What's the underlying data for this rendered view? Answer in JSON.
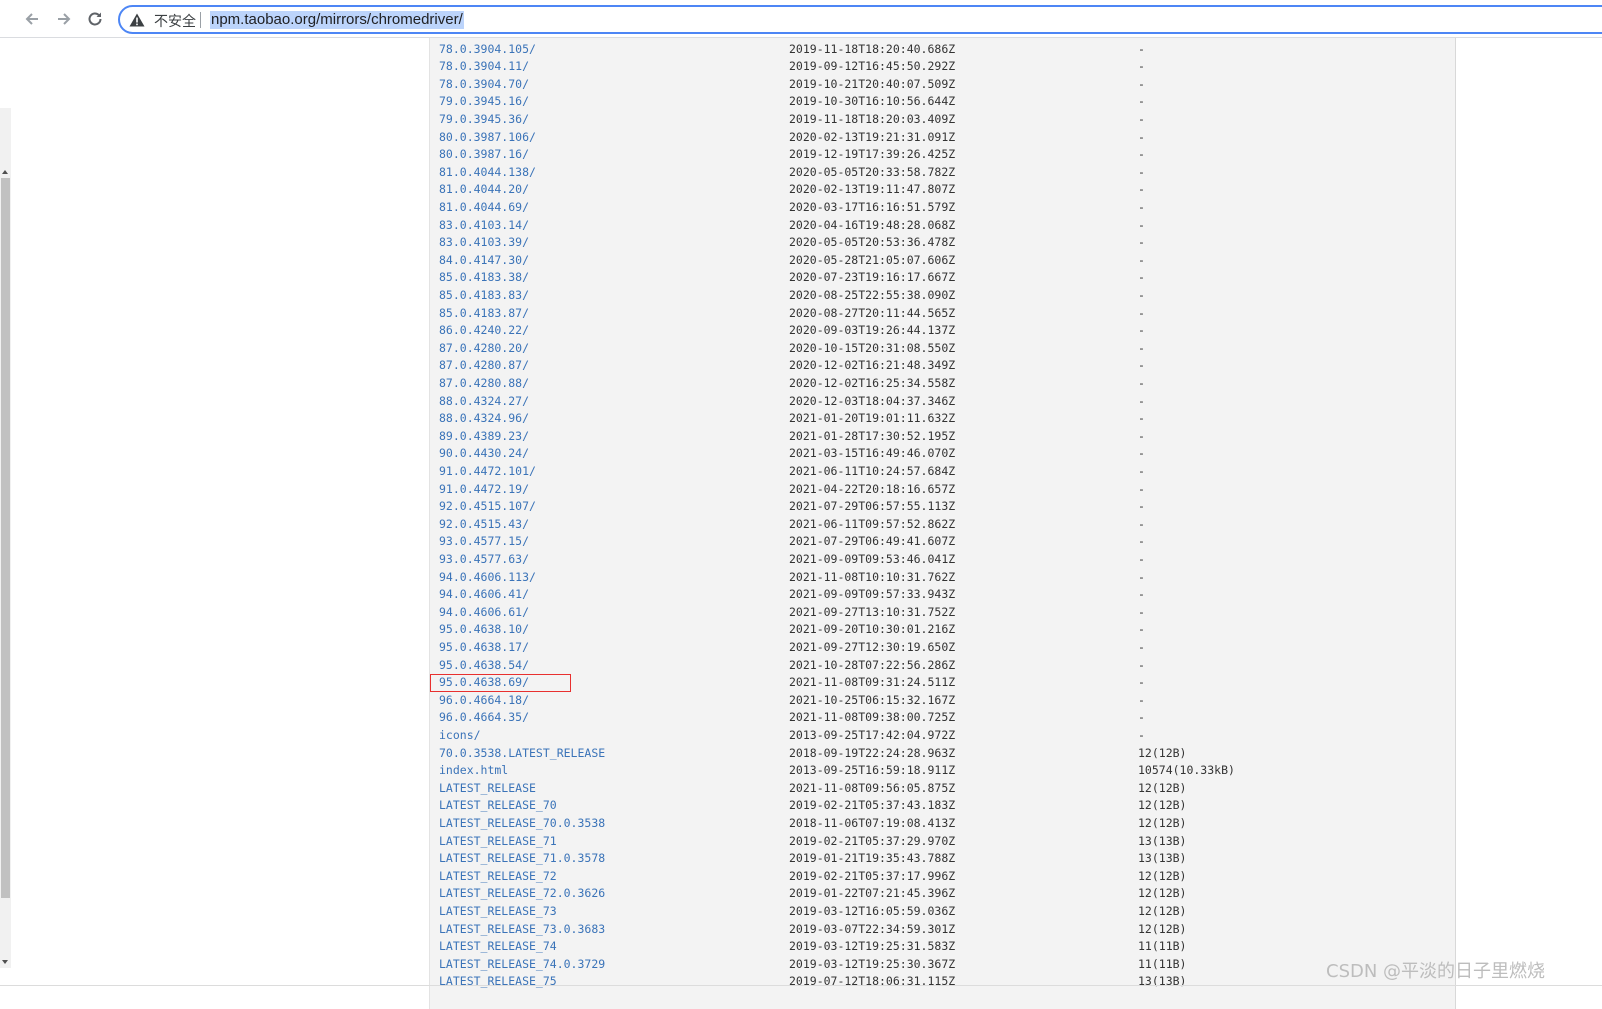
{
  "browser": {
    "security_label": "不安全",
    "url": "npm.taobao.org/mirrors/chromedriver/"
  },
  "listing": {
    "rows": [
      {
        "name": "78.0.3904.105/",
        "date": "2019-11-18T18:20:40.686Z",
        "size": "-"
      },
      {
        "name": "78.0.3904.11/",
        "date": "2019-09-12T16:45:50.292Z",
        "size": "-"
      },
      {
        "name": "78.0.3904.70/",
        "date": "2019-10-21T20:40:07.509Z",
        "size": "-"
      },
      {
        "name": "79.0.3945.16/",
        "date": "2019-10-30T16:10:56.644Z",
        "size": "-"
      },
      {
        "name": "79.0.3945.36/",
        "date": "2019-11-18T18:20:03.409Z",
        "size": "-"
      },
      {
        "name": "80.0.3987.106/",
        "date": "2020-02-13T19:21:31.091Z",
        "size": "-"
      },
      {
        "name": "80.0.3987.16/",
        "date": "2019-12-19T17:39:26.425Z",
        "size": "-"
      },
      {
        "name": "81.0.4044.138/",
        "date": "2020-05-05T20:33:58.782Z",
        "size": "-"
      },
      {
        "name": "81.0.4044.20/",
        "date": "2020-02-13T19:11:47.807Z",
        "size": "-"
      },
      {
        "name": "81.0.4044.69/",
        "date": "2020-03-17T16:16:51.579Z",
        "size": "-"
      },
      {
        "name": "83.0.4103.14/",
        "date": "2020-04-16T19:48:28.068Z",
        "size": "-"
      },
      {
        "name": "83.0.4103.39/",
        "date": "2020-05-05T20:53:36.478Z",
        "size": "-"
      },
      {
        "name": "84.0.4147.30/",
        "date": "2020-05-28T21:05:07.606Z",
        "size": "-"
      },
      {
        "name": "85.0.4183.38/",
        "date": "2020-07-23T19:16:17.667Z",
        "size": "-"
      },
      {
        "name": "85.0.4183.83/",
        "date": "2020-08-25T22:55:38.090Z",
        "size": "-"
      },
      {
        "name": "85.0.4183.87/",
        "date": "2020-08-27T20:11:44.565Z",
        "size": "-"
      },
      {
        "name": "86.0.4240.22/",
        "date": "2020-09-03T19:26:44.137Z",
        "size": "-"
      },
      {
        "name": "87.0.4280.20/",
        "date": "2020-10-15T20:31:08.550Z",
        "size": "-"
      },
      {
        "name": "87.0.4280.87/",
        "date": "2020-12-02T16:21:48.349Z",
        "size": "-"
      },
      {
        "name": "87.0.4280.88/",
        "date": "2020-12-02T16:25:34.558Z",
        "size": "-"
      },
      {
        "name": "88.0.4324.27/",
        "date": "2020-12-03T18:04:37.346Z",
        "size": "-"
      },
      {
        "name": "88.0.4324.96/",
        "date": "2021-01-20T19:01:11.632Z",
        "size": "-"
      },
      {
        "name": "89.0.4389.23/",
        "date": "2021-01-28T17:30:52.195Z",
        "size": "-"
      },
      {
        "name": "90.0.4430.24/",
        "date": "2021-03-15T16:49:46.070Z",
        "size": "-"
      },
      {
        "name": "91.0.4472.101/",
        "date": "2021-06-11T10:24:57.684Z",
        "size": "-"
      },
      {
        "name": "91.0.4472.19/",
        "date": "2021-04-22T20:18:16.657Z",
        "size": "-"
      },
      {
        "name": "92.0.4515.107/",
        "date": "2021-07-29T06:57:55.113Z",
        "size": "-"
      },
      {
        "name": "92.0.4515.43/",
        "date": "2021-06-11T09:57:52.862Z",
        "size": "-"
      },
      {
        "name": "93.0.4577.15/",
        "date": "2021-07-29T06:49:41.607Z",
        "size": "-"
      },
      {
        "name": "93.0.4577.63/",
        "date": "2021-09-09T09:53:46.041Z",
        "size": "-"
      },
      {
        "name": "94.0.4606.113/",
        "date": "2021-11-08T10:10:31.762Z",
        "size": "-"
      },
      {
        "name": "94.0.4606.41/",
        "date": "2021-09-09T09:57:33.943Z",
        "size": "-"
      },
      {
        "name": "94.0.4606.61/",
        "date": "2021-09-27T13:10:31.752Z",
        "size": "-"
      },
      {
        "name": "95.0.4638.10/",
        "date": "2021-09-20T10:30:01.216Z",
        "size": "-"
      },
      {
        "name": "95.0.4638.17/",
        "date": "2021-09-27T12:30:19.650Z",
        "size": "-"
      },
      {
        "name": "95.0.4638.54/",
        "date": "2021-10-28T07:22:56.286Z",
        "size": "-"
      },
      {
        "name": "95.0.4638.69/",
        "date": "2021-11-08T09:31:24.511Z",
        "size": "-"
      },
      {
        "name": "96.0.4664.18/",
        "date": "2021-10-25T06:15:32.167Z",
        "size": "-"
      },
      {
        "name": "96.0.4664.35/",
        "date": "2021-11-08T09:38:00.725Z",
        "size": "-"
      },
      {
        "name": "icons/",
        "date": "2013-09-25T17:42:04.972Z",
        "size": "-"
      },
      {
        "name": "70.0.3538.LATEST_RELEASE",
        "date": "2018-09-19T22:24:28.963Z",
        "size": "12(12B)"
      },
      {
        "name": "index.html",
        "date": "2013-09-25T16:59:18.911Z",
        "size": "10574(10.33kB)"
      },
      {
        "name": "LATEST_RELEASE",
        "date": "2021-11-08T09:56:05.875Z",
        "size": "12(12B)"
      },
      {
        "name": "LATEST_RELEASE_70",
        "date": "2019-02-21T05:37:43.183Z",
        "size": "12(12B)"
      },
      {
        "name": "LATEST_RELEASE_70.0.3538",
        "date": "2018-11-06T07:19:08.413Z",
        "size": "12(12B)"
      },
      {
        "name": "LATEST_RELEASE_71",
        "date": "2019-02-21T05:37:29.970Z",
        "size": "13(13B)"
      },
      {
        "name": "LATEST_RELEASE_71.0.3578",
        "date": "2019-01-21T19:35:43.788Z",
        "size": "13(13B)"
      },
      {
        "name": "LATEST_RELEASE_72",
        "date": "2019-02-21T05:37:17.996Z",
        "size": "12(12B)"
      },
      {
        "name": "LATEST_RELEASE_72.0.3626",
        "date": "2019-01-22T07:21:45.396Z",
        "size": "12(12B)"
      },
      {
        "name": "LATEST_RELEASE_73",
        "date": "2019-03-12T16:05:59.036Z",
        "size": "12(12B)"
      },
      {
        "name": "LATEST_RELEASE_73.0.3683",
        "date": "2019-03-07T22:34:59.301Z",
        "size": "12(12B)"
      },
      {
        "name": "LATEST_RELEASE_74",
        "date": "2019-03-12T19:25:31.583Z",
        "size": "11(11B)"
      },
      {
        "name": "LATEST_RELEASE_74.0.3729",
        "date": "2019-03-12T19:25:30.367Z",
        "size": "11(11B)"
      },
      {
        "name": "LATEST_RELEASE_75",
        "date": "2019-07-12T18:06:31.115Z",
        "size": "13(13B)"
      }
    ]
  },
  "watermark": "CSDN @平淡的日子里燃烧",
  "colors": {
    "link": "#3a73b8",
    "highlight_box": "#e8302f",
    "omnibox_border": "#4d86f5"
  }
}
